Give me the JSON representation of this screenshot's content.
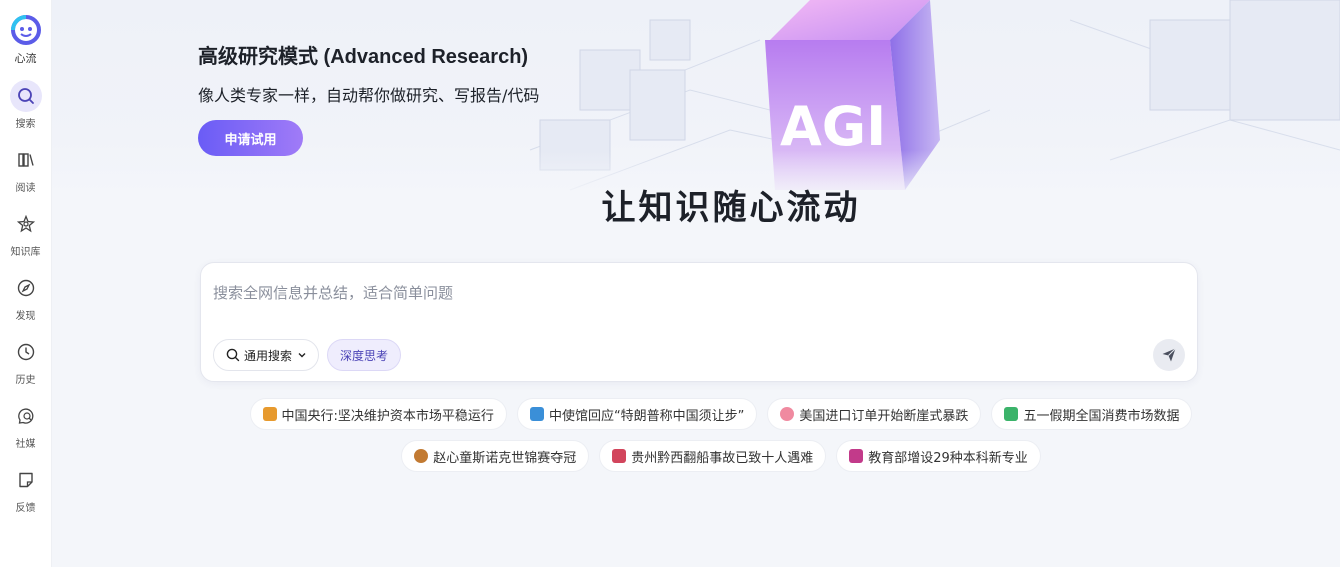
{
  "app": {
    "logo_text": "心流"
  },
  "sidebar": {
    "items": [
      {
        "label": "搜索",
        "icon": "search-icon",
        "active": true
      },
      {
        "label": "阅读",
        "icon": "book-icon",
        "active": false
      },
      {
        "label": "知识库",
        "icon": "knowledge-icon",
        "active": false
      },
      {
        "label": "发现",
        "icon": "compass-icon",
        "active": false
      },
      {
        "label": "历史",
        "icon": "clock-icon",
        "active": false
      },
      {
        "label": "社媒",
        "icon": "social-icon",
        "active": false
      },
      {
        "label": "反馈",
        "icon": "feedback-icon",
        "active": false
      }
    ]
  },
  "banner": {
    "title": "高级研究模式 (Advanced Research)",
    "subtitle": "像人类专家一样，自动帮你做研究、写报告/代码",
    "button": "申请试用",
    "art_text": "AGI"
  },
  "hero": {
    "slogan": "让知识随心流动"
  },
  "search": {
    "placeholder": "搜索全网信息并总结，适合简单问题",
    "value": "",
    "mode": "通用搜索",
    "deep_label": "深度思考"
  },
  "trending": {
    "row1": [
      {
        "text": "中国央行:坚决维护资本市场平稳运行",
        "icon_color": "#e79a2e"
      },
      {
        "text": "中使馆回应“特朗普称中国须让步”",
        "icon_color": "#3a8fd8"
      },
      {
        "text": "美国进口订单开始断崖式暴跌",
        "icon_color": "#f08aa0"
      },
      {
        "text": "五一假期全国消费市场数据",
        "icon_color": "#3bb36a"
      }
    ],
    "row2": [
      {
        "text": "赵心童斯诺克世锦赛夺冠",
        "icon_color": "#c27a32"
      },
      {
        "text": "贵州黔西翻船事故已致十人遇难",
        "icon_color": "#d2455c"
      },
      {
        "text": "教育部增设29种本科新专业",
        "icon_color": "#c23a8a"
      }
    ]
  },
  "colors": {
    "accent": "#6a5cf6",
    "accent_light": "#efedfd",
    "background": "#f4f6fa"
  }
}
